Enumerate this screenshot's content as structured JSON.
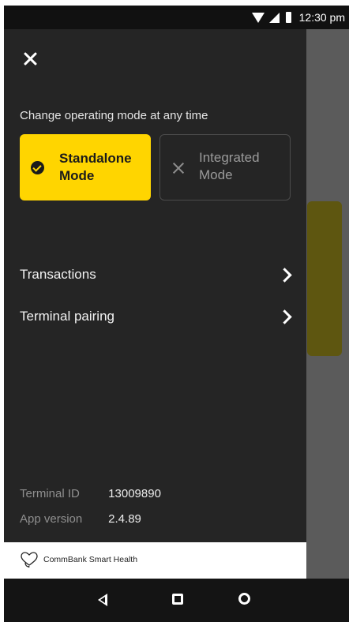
{
  "status_bar": {
    "time": "12:30 pm",
    "icons": [
      "wifi-icon",
      "signal-icon",
      "battery-icon"
    ]
  },
  "drawer": {
    "close_icon": "close-icon",
    "mode_heading": "Change operating mode at any time",
    "modes": [
      {
        "label": "Standalone Mode",
        "selected": true,
        "icon": "check-circle-icon"
      },
      {
        "label": "Integrated Mode",
        "selected": false,
        "icon": "x-icon"
      }
    ],
    "menu": [
      {
        "label": "Transactions",
        "icon": "chevron-right-icon"
      },
      {
        "label": "Terminal pairing",
        "icon": "chevron-right-icon"
      }
    ],
    "info": {
      "terminal_id_label": "Terminal ID",
      "terminal_id": "13009890",
      "app_version_label": "App version",
      "app_version": "2.4.89"
    },
    "brand": {
      "name": "CommBank Smart Health",
      "logo_icon": "heart-stethoscope-icon"
    }
  },
  "nav_bar": {
    "icons": [
      "back-icon",
      "recents-icon",
      "home-icon"
    ]
  },
  "colors": {
    "accent": "#ffd500",
    "drawer_bg": "#252525",
    "status_bg": "#111111",
    "nav_bg": "#141414",
    "backdrop_card": "#5e5610"
  }
}
